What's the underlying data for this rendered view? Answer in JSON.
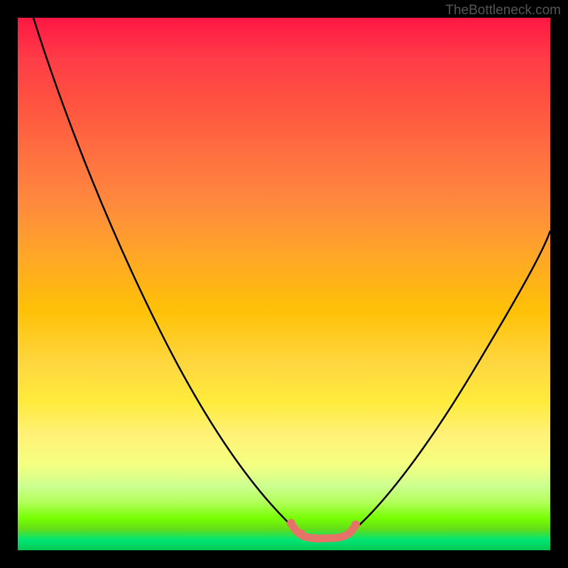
{
  "watermark": "TheBottleneck.com",
  "chart_data": {
    "type": "line",
    "title": "",
    "xlabel": "",
    "ylabel": "",
    "xlim": [
      0,
      100
    ],
    "ylim": [
      0,
      100
    ],
    "series": [
      {
        "name": "bottleneck-curve",
        "x": [
          3,
          10,
          20,
          30,
          40,
          48,
          52,
          55,
          58,
          60,
          65,
          75,
          85,
          95,
          100
        ],
        "y": [
          100,
          82,
          60,
          40,
          22,
          8,
          3,
          2,
          2,
          2.5,
          5,
          18,
          35,
          52,
          60
        ]
      },
      {
        "name": "optimal-zone",
        "x": [
          52,
          53,
          54,
          55,
          56,
          57,
          58,
          59,
          60,
          61
        ],
        "y": [
          3,
          2.5,
          2.2,
          2,
          2,
          2,
          2,
          2.2,
          2.5,
          3
        ]
      }
    ],
    "gradient_stops": [
      {
        "pos": 0,
        "color": "#ff1744"
      },
      {
        "pos": 50,
        "color": "#ffc107"
      },
      {
        "pos": 100,
        "color": "#00c853"
      }
    ]
  }
}
